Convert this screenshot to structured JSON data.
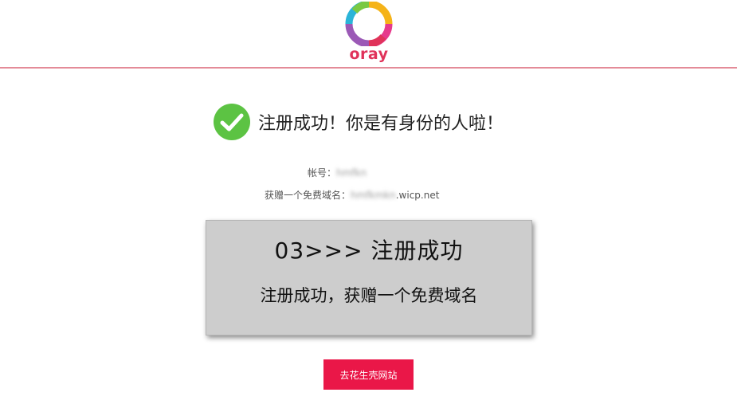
{
  "header": {
    "logo_text": "oray",
    "logo_icon": "oray-ring-logo",
    "accent_line_color": "#e48b98",
    "brand_color": "#e0335a"
  },
  "success": {
    "icon": "check-circle-icon",
    "icon_color": "#5cc343",
    "title": "注册成功！你是有身份的人啦！"
  },
  "account": {
    "label": "帐号：",
    "value": "hmfkn"
  },
  "domain": {
    "label": "获赠一个免费域名：",
    "blurred_prefix": "hmfkmkn",
    "suffix": ".wicp.net"
  },
  "overlay": {
    "step": "03>>>  注册成功",
    "description": "注册成功，获赠一个免费域名"
  },
  "button": {
    "label": "去花生壳网站",
    "color": "#ea1748"
  }
}
